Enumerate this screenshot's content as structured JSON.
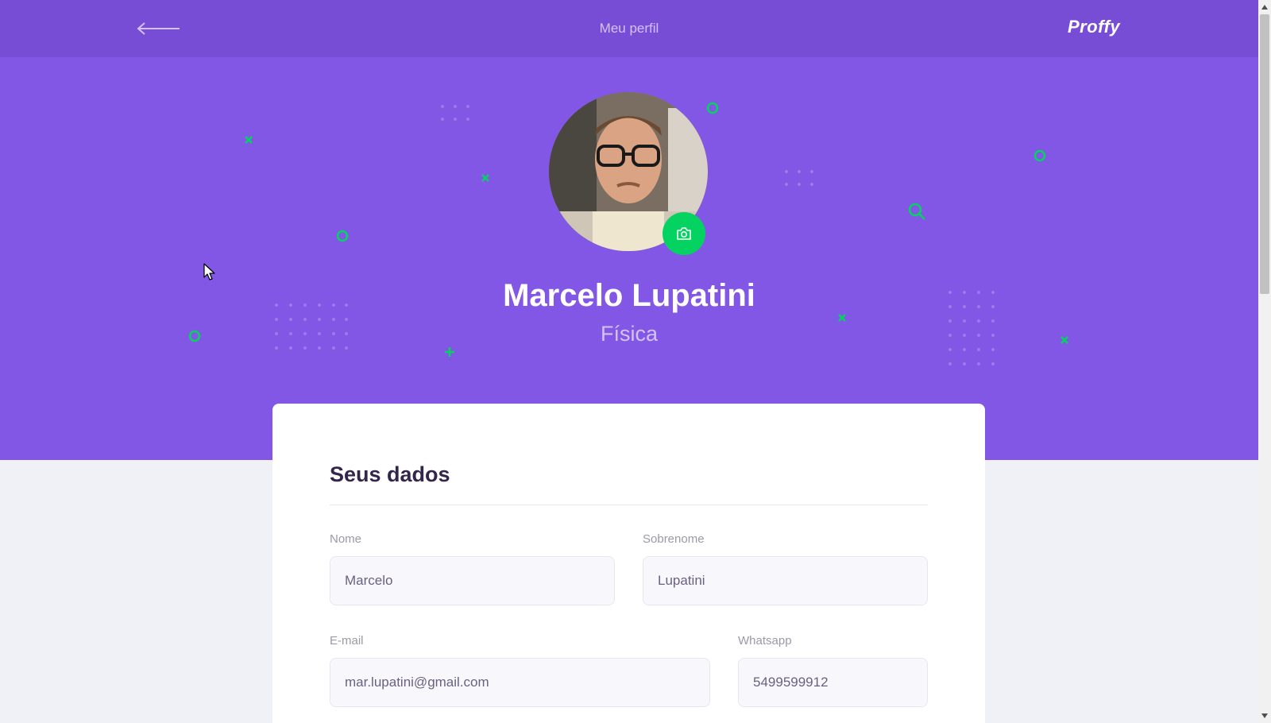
{
  "header": {
    "back_icon": "arrow-left-icon",
    "title": "Meu perfil",
    "brand": "Proffy"
  },
  "profile": {
    "name": "Marcelo Lupatini",
    "subject": "Física",
    "avatar_icon": "user-avatar-photo",
    "camera_icon": "camera-icon"
  },
  "form": {
    "section_title": "Seus dados",
    "fields": {
      "first_name": {
        "label": "Nome",
        "value": "Marcelo"
      },
      "last_name": {
        "label": "Sobrenome",
        "value": "Lupatini"
      },
      "email": {
        "label": "E-mail",
        "value": "mar.lupatini@gmail.com"
      },
      "whatsapp": {
        "label": "Whatsapp",
        "value": "5499599912"
      }
    }
  },
  "colors": {
    "primary": "#8257E5",
    "primary_dark": "#774DD6",
    "accent_green": "#04D361",
    "text_title": "#32264D",
    "text_label": "#9C98A6",
    "background": "#F0F0F7"
  }
}
